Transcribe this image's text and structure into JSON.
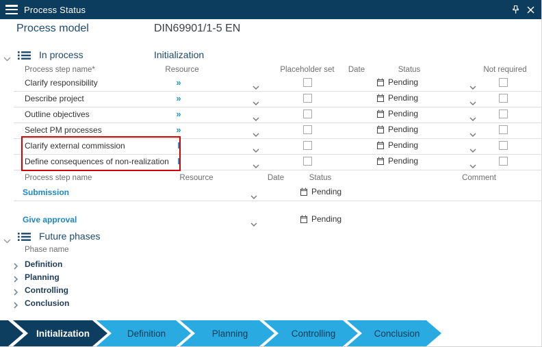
{
  "titlebar": {
    "title": "Process Status"
  },
  "header": {
    "label": "Process model",
    "value": "DIN69901/1-5 EN"
  },
  "in_process": {
    "title": "In process",
    "phase": "Initialization",
    "columns": {
      "name": "Process step name*",
      "resource": "Resource",
      "placeholder": "Placeholder set",
      "date": "Date",
      "status": "Status",
      "not_required": "Not required"
    },
    "rows": [
      {
        "name": "Clarify responsibility",
        "resource": "»",
        "status": "Pending"
      },
      {
        "name": "Describe project",
        "resource": "»",
        "status": "Pending"
      },
      {
        "name": "Outline objectives",
        "resource": "»",
        "status": "Pending"
      },
      {
        "name": "Select PM processes",
        "resource": "»",
        "status": "Pending"
      },
      {
        "name": "Clarify external commission",
        "resource": "I",
        "status": "Pending"
      },
      {
        "name": "Define consequences of non-realization",
        "resource": "I",
        "status": "Pending"
      }
    ]
  },
  "milestones": {
    "columns": {
      "name": "Process step name",
      "resource": "Resource",
      "date": "Date",
      "status": "Status",
      "comment": "Comment"
    },
    "rows": [
      {
        "name": "Submission",
        "status": "Pending"
      },
      {
        "name": "Give approval",
        "status": "Pending"
      }
    ]
  },
  "future_phases": {
    "title": "Future phases",
    "column": "Phase name",
    "items": [
      "Definition",
      "Planning",
      "Controlling",
      "Conclusion"
    ]
  },
  "phase_bar": {
    "active": "Initialization",
    "phases": [
      "Initialization",
      "Definition",
      "Planning",
      "Controlling",
      "Conclusion"
    ]
  },
  "colors": {
    "titlebar": "#0c3c5e",
    "navy_text": "#1c4a6e",
    "link_blue": "#2095d2",
    "arrow_active": "#0e3e5f",
    "arrow_future": "#29abe2",
    "highlight_red": "#d40000"
  }
}
